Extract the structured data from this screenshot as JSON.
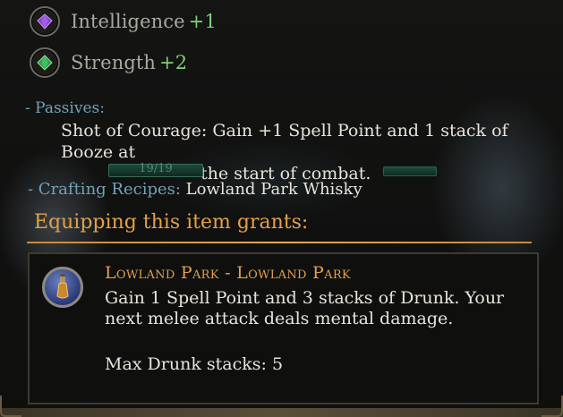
{
  "stats": [
    {
      "name": "Intelligence",
      "value": "+1",
      "gem_color": "#8a3fd0",
      "icon": "purple-gem-icon"
    },
    {
      "name": "Strength",
      "value": "+2",
      "gem_color": "#2f9a4a",
      "icon": "green-gem-icon"
    }
  ],
  "passives": {
    "label": "- Passives:",
    "line1": "Shot of Courage: Gain +1 Spell Point and 1 stack of Booze at",
    "line2": "the start of combat."
  },
  "health_bar": {
    "text": "19/19"
  },
  "crafting": {
    "label": "- Crafting Recipes:",
    "value": "Lowland Park Whisky"
  },
  "grants": {
    "header": "Equipping this item grants:",
    "ability": {
      "icon": "whisky-bottle-icon",
      "title": "Lowland Park - Lowland Park",
      "desc": "Gain 1 Spell Point and 3 stacks of Drunk. Your next melee attack deals mental damage.",
      "extra": "Max Drunk stacks: 5"
    }
  },
  "colors": {
    "accent_orange": "#e3a149",
    "stat_green": "#7fd17b",
    "label_blue": "#6fa3b8",
    "body_text": "#e8e4da"
  }
}
